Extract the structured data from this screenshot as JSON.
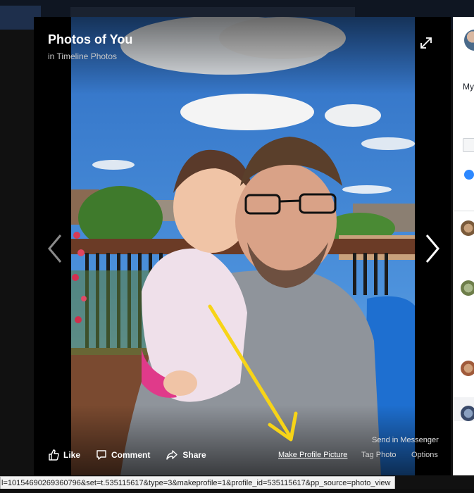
{
  "viewer": {
    "title": "Photos of You",
    "subtitle": "in Timeline Photos",
    "expand_icon": "expand-icon",
    "prev_icon": "chevron-left-icon",
    "next_icon": "chevron-right-icon"
  },
  "actions": {
    "like": "Like",
    "comment": "Comment",
    "share": "Share",
    "send_in_messenger": "Send in Messenger",
    "make_profile_picture": "Make Profile Picture",
    "tag_photo": "Tag Photo",
    "options": "Options"
  },
  "right_panel": {
    "post_text": "My"
  },
  "annotation": {
    "arrow_color": "#f7d417"
  },
  "statusbar": {
    "url": "l=10154690269360796&set=t.535115617&type=3&makeprofile=1&profile_id=535115617&pp_source=photo_view"
  }
}
